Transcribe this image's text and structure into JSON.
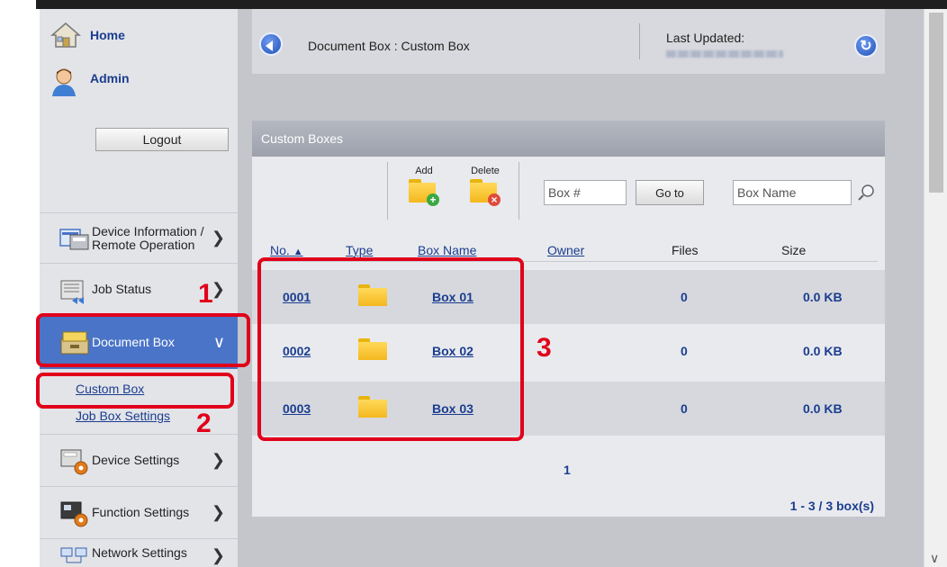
{
  "sidebar": {
    "home_label": "Home",
    "user_label": "Admin",
    "logout_label": "Logout",
    "items": [
      {
        "label_line1": "Device Information /",
        "label_line2": "Remote Operation"
      },
      {
        "label": "Job Status"
      },
      {
        "label": "Document Box"
      },
      {
        "label": "Device Settings"
      },
      {
        "label": "Function Settings"
      },
      {
        "label": "Network Settings"
      }
    ],
    "sub_items": [
      "Custom Box",
      "Job Box Settings"
    ]
  },
  "header": {
    "title": "Document Box : Custom Box",
    "last_updated_label": "Last Updated:"
  },
  "panel": {
    "title": "Custom Boxes",
    "add_label": "Add",
    "delete_label": "Delete",
    "box_number_placeholder": "Box #",
    "goto_label": "Go to",
    "box_name_placeholder": "Box Name",
    "columns": [
      "No.",
      "Type",
      "Box Name",
      "Owner",
      "Files",
      "Size"
    ],
    "rows": [
      {
        "no": "0001",
        "name": "Box 01",
        "owner": "",
        "files": "0",
        "size": "0.0 KB"
      },
      {
        "no": "0002",
        "name": "Box 02",
        "owner": "",
        "files": "0",
        "size": "0.0 KB"
      },
      {
        "no": "0003",
        "name": "Box 03",
        "owner": "",
        "files": "0",
        "size": "0.0 KB"
      }
    ],
    "page": "1",
    "summary": "1 - 3 / 3 box(s)"
  },
  "callouts": [
    "1",
    "2",
    "3"
  ],
  "colors": {
    "accent": "#4a74c7",
    "highlight": "#e1001a",
    "link": "#1b3d8f",
    "folder": "#f4b81e"
  },
  "icons": [
    "home-icon",
    "admin-user-icon",
    "device-info-icon",
    "job-status-icon",
    "document-box-icon",
    "device-settings-icon",
    "function-settings-icon",
    "network-settings-icon",
    "back-arrow-icon",
    "refresh-icon",
    "folder-add-icon",
    "folder-delete-icon",
    "magnifier-icon",
    "sort-ascending-icon"
  ]
}
